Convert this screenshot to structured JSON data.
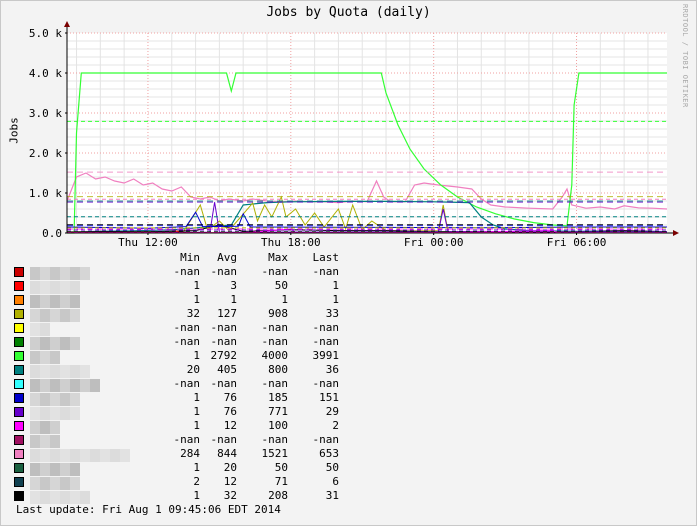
{
  "chart_data": {
    "type": "line",
    "title": "Jobs by Quota (daily)",
    "ylabel": "Jobs",
    "watermark": "RRDTOOL / TOBI OETIKER",
    "ylim": [
      0,
      5000
    ],
    "yticks": [
      "0.0",
      "1.0 k",
      "2.0 k",
      "3.0 k",
      "4.0 k",
      "5.0 k"
    ],
    "xlim_hours": [
      8.6,
      33.8
    ],
    "xticks": [
      {
        "label": "Thu 12:00",
        "hour": 12
      },
      {
        "label": "Thu 18:00",
        "hour": 18
      },
      {
        "label": "Fri 00:00",
        "hour": 24
      },
      {
        "label": "Fri 06:00",
        "hour": 30
      }
    ],
    "grid": true,
    "legend_columns": [
      "Min",
      "Avg",
      "Max",
      "Last"
    ],
    "series": [
      {
        "color": "#cc0000",
        "stats": [
          "-nan",
          "-nan",
          "-nan",
          "-nan"
        ]
      },
      {
        "color": "#ff0000",
        "stats": [
          "1",
          "3",
          "50",
          "1"
        ]
      },
      {
        "color": "#ff8000",
        "stats": [
          "1",
          "1",
          "1",
          "1"
        ]
      },
      {
        "color": "#b0b000",
        "stats": [
          "32",
          "127",
          "908",
          "33"
        ]
      },
      {
        "color": "#ffff00",
        "stats": [
          "-nan",
          "-nan",
          "-nan",
          "-nan"
        ]
      },
      {
        "color": "#008000",
        "stats": [
          "-nan",
          "-nan",
          "-nan",
          "-nan"
        ]
      },
      {
        "color": "#33ff33",
        "stats": [
          "1",
          "2792",
          "4000",
          "3991"
        ]
      },
      {
        "color": "#008080",
        "stats": [
          "20",
          "405",
          "800",
          "36"
        ]
      },
      {
        "color": "#33ffff",
        "stats": [
          "-nan",
          "-nan",
          "-nan",
          "-nan"
        ]
      },
      {
        "color": "#0000cc",
        "stats": [
          "1",
          "76",
          "185",
          "151"
        ]
      },
      {
        "color": "#6600cc",
        "stats": [
          "1",
          "76",
          "771",
          "29"
        ]
      },
      {
        "color": "#ff00ff",
        "stats": [
          "1",
          "12",
          "100",
          "2"
        ]
      },
      {
        "color": "#a01060",
        "stats": [
          "-nan",
          "-nan",
          "-nan",
          "-nan"
        ]
      },
      {
        "color": "#f080c0",
        "stats": [
          "284",
          "844",
          "1521",
          "653"
        ]
      },
      {
        "color": "#1a6040",
        "stats": [
          "1",
          "20",
          "50",
          "50"
        ]
      },
      {
        "color": "#104050",
        "stats": [
          "2",
          "12",
          "71",
          "6"
        ]
      },
      {
        "color": "#000000",
        "stats": [
          "1",
          "32",
          "208",
          "31"
        ]
      }
    ],
    "footer": "Last update: Fri Aug  1 09:45:06 EDT 2014"
  }
}
